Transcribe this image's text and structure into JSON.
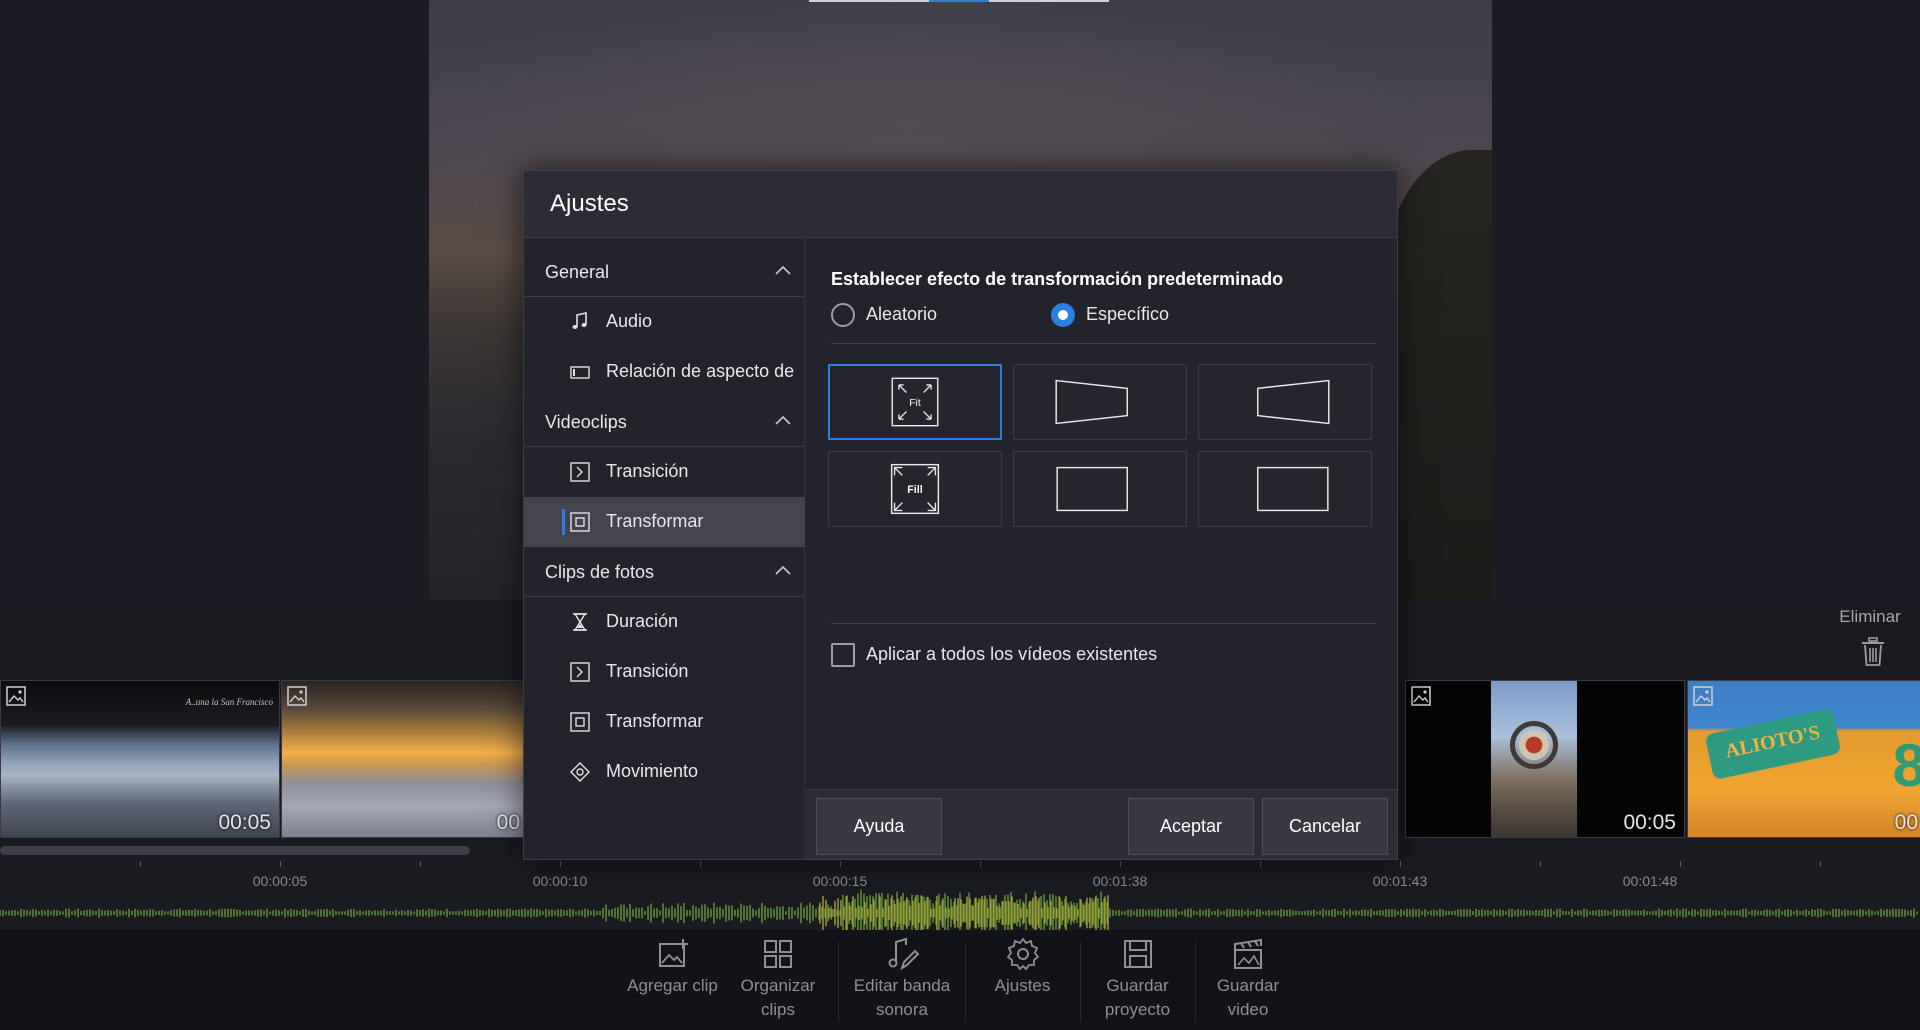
{
  "dialog": {
    "title": "Ajustes",
    "nav": {
      "group_general": "General",
      "item_audio": "Audio",
      "item_aspect": "Relación de aspecto de",
      "group_videoclips": "Videoclips",
      "item_video_transition": "Transición",
      "item_video_transform": "Transformar",
      "group_photoclips": "Clips de fotos",
      "item_photo_duration": "Duración",
      "item_photo_transition": "Transición",
      "item_photo_transform": "Transformar",
      "item_photo_motion": "Movimiento"
    },
    "content": {
      "section_title": "Establecer efecto de transformación predeterminado",
      "radio_random": "Aleatorio",
      "radio_specific": "Específico",
      "selected_mode": "Específico",
      "effects": {
        "fit_label": "Fit",
        "fill_label": "Fill",
        "selected": "Fit"
      },
      "apply_all_label": "Aplicar a todos los vídeos existentes",
      "apply_all_checked": false
    },
    "footer": {
      "help": "Ayuda",
      "accept": "Aceptar",
      "cancel": "Cancelar"
    }
  },
  "timeline": {
    "delete_label": "Eliminar",
    "clips": [
      {
        "duration": "00:05"
      },
      {
        "duration": "00"
      },
      {
        "duration": "00:05"
      },
      {
        "duration": "00"
      }
    ],
    "clip1_caption": "A..una la San Francisco",
    "clip4_sign": "ALIOTO'S",
    "clip4_digit": "8",
    "time_labels": [
      "00:00:05",
      "00:00:10",
      "00:00:15",
      "00:01:38",
      "00:01:43",
      "00:01:48"
    ]
  },
  "toolbar": {
    "add_clip": "Agregar clip",
    "organize_1": "Organizar",
    "organize_2": "clips",
    "edit_1": "Editar banda",
    "edit_2": "sonora",
    "settings": "Ajustes",
    "save_project_1": "Guardar",
    "save_project_2": "proyecto",
    "save_video_1": "Guardar",
    "save_video_2": "video"
  },
  "colors": {
    "accent": "#2b7fe0",
    "dialog_bg": "#22232b",
    "header_bg": "#2b2c35"
  }
}
